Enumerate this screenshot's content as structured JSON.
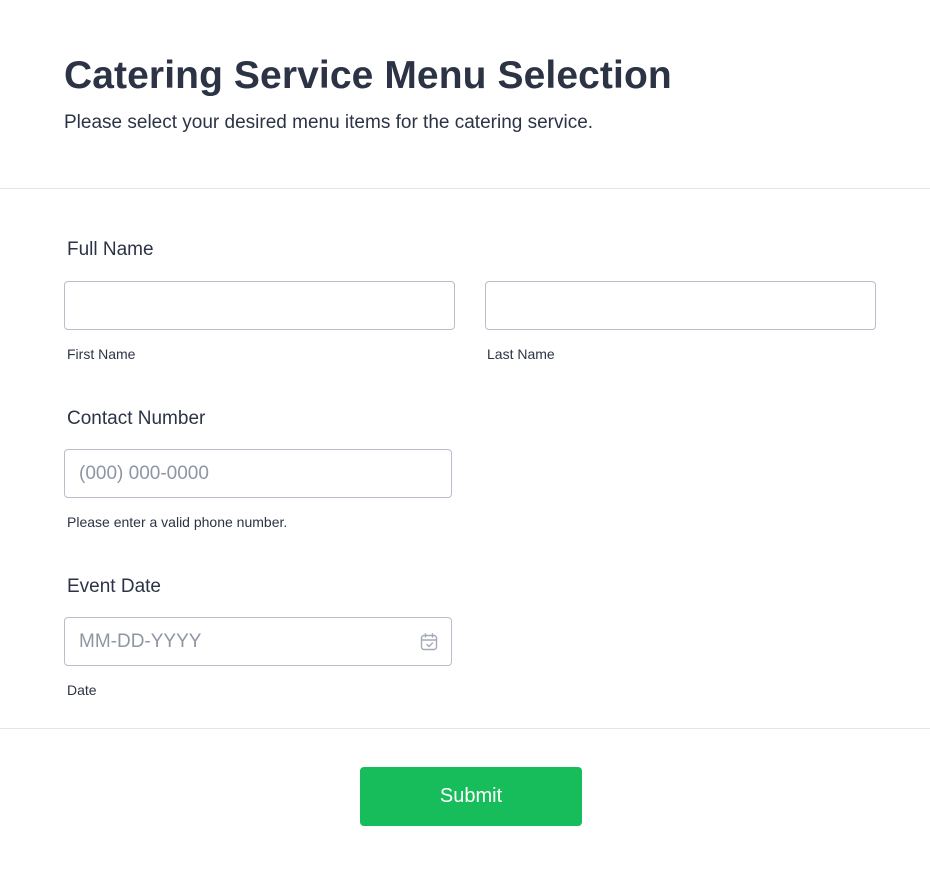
{
  "header": {
    "title": "Catering Service Menu Selection",
    "subtitle": "Please select your desired menu items for the catering service."
  },
  "fields": {
    "full_name": {
      "label": "Full Name",
      "first_name": {
        "value": "",
        "placeholder": "",
        "sublabel": "First Name"
      },
      "last_name": {
        "value": "",
        "placeholder": "",
        "sublabel": "Last Name"
      }
    },
    "contact_number": {
      "label": "Contact Number",
      "value": "",
      "placeholder": "(000) 000-0000",
      "sublabel": "Please enter a valid phone number."
    },
    "event_date": {
      "label": "Event Date",
      "value": "",
      "placeholder": "MM-DD-YYYY",
      "sublabel": "Date",
      "icon": "calendar-icon"
    }
  },
  "submit": {
    "label": "Submit"
  },
  "colors": {
    "text": "#2c3345",
    "border": "#b8bdc9",
    "placeholder": "#8f96a3",
    "divider": "#e3e5ea",
    "submit_bg": "#18bd5b",
    "submit_text": "#ffffff"
  }
}
